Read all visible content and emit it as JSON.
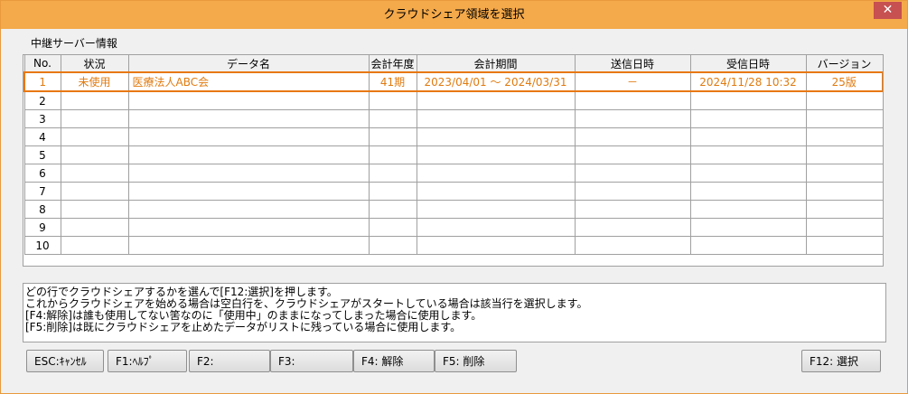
{
  "window": {
    "title": "クラウドシェア領域を選択",
    "close_label": "✕"
  },
  "group_label": "中継サーバー情報",
  "table": {
    "headers": [
      "No.",
      "状況",
      "データ名",
      "会計年度",
      "会計期間",
      "送信日時",
      "受信日時",
      "バージョン"
    ],
    "rows": [
      [
        "1",
        "未使用",
        "医療法人ABC会",
        "41期",
        "2023/04/01 ～ 2024/03/31",
        "－",
        "2024/11/28 10:32",
        "25版"
      ],
      [
        "2",
        "",
        "",
        "",
        "",
        "",
        "",
        ""
      ],
      [
        "3",
        "",
        "",
        "",
        "",
        "",
        "",
        ""
      ],
      [
        "4",
        "",
        "",
        "",
        "",
        "",
        "",
        ""
      ],
      [
        "5",
        "",
        "",
        "",
        "",
        "",
        "",
        ""
      ],
      [
        "6",
        "",
        "",
        "",
        "",
        "",
        "",
        ""
      ],
      [
        "7",
        "",
        "",
        "",
        "",
        "",
        "",
        ""
      ],
      [
        "8",
        "",
        "",
        "",
        "",
        "",
        "",
        ""
      ],
      [
        "9",
        "",
        "",
        "",
        "",
        "",
        "",
        ""
      ],
      [
        "10",
        "",
        "",
        "",
        "",
        "",
        "",
        ""
      ]
    ]
  },
  "message_lines": [
    "どの行でクラウドシェアするかを選んで[F12:選択]を押します。",
    "これからクラウドシェアを始める場合は空白行を、クラウドシェアがスタートしている場合は該当行を選択します。",
    "[F4:解除]は誰も使用してない筈なのに「使用中」のままになってしまった場合に使用します。",
    "[F5:削除]は既にクラウドシェアを止めたデータがリストに残っている場合に使用します。"
  ],
  "buttons": {
    "esc": "ESC:ｷｬﾝｾﾙ",
    "f1": "F1:ﾍﾙﾌﾟ",
    "f2": "F2:",
    "f3": "F3:",
    "f4": "F4: 解除",
    "f5": "F5: 削除",
    "f12": "F12: 選択"
  },
  "colors": {
    "title_bar": "#f4a94a",
    "selection": "#e87810",
    "close": "#c75050"
  }
}
